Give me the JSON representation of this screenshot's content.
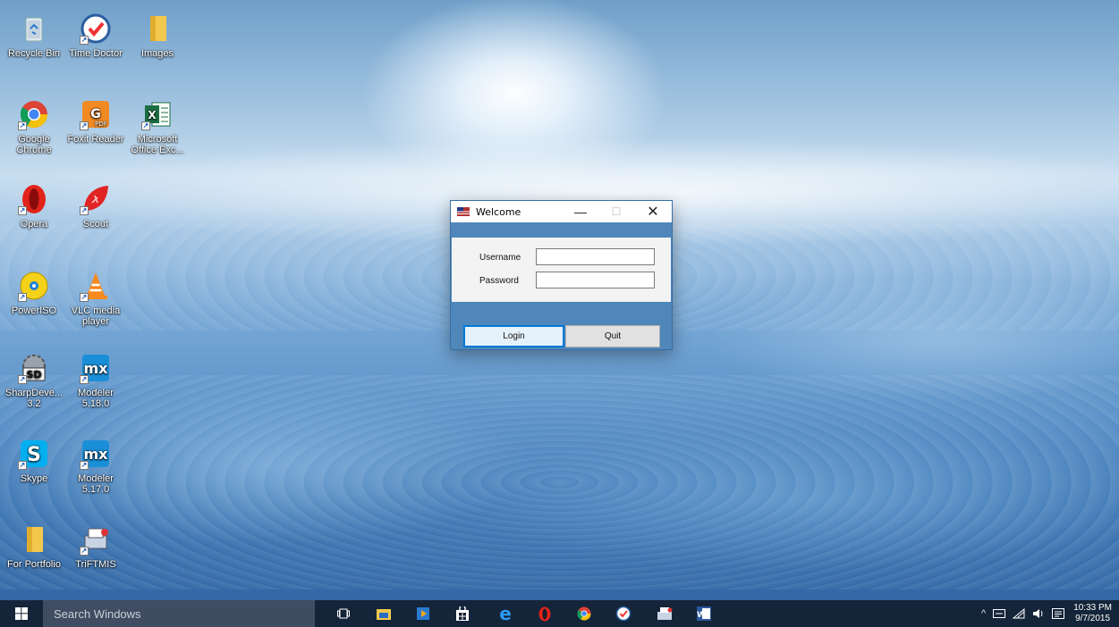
{
  "desktop": {
    "icons": [
      {
        "label": "Recycle Bin"
      },
      {
        "label": "Time Doctor"
      },
      {
        "label": "Images"
      },
      {
        "label": "Google Chrome"
      },
      {
        "label": "Foxit Reader"
      },
      {
        "label": "Microsoft Office Exc..."
      },
      {
        "label": "Opera"
      },
      {
        "label": "Scout"
      },
      {
        "label": "PowerISO"
      },
      {
        "label": "VLC media player"
      },
      {
        "label": "SharpDeve... 3.2"
      },
      {
        "label": "Modeler 5.18.0"
      },
      {
        "label": "Skype"
      },
      {
        "label": "Modeler 5.17.0"
      },
      {
        "label": "For Portfolio"
      },
      {
        "label": "TriFTMIS"
      }
    ]
  },
  "dialog": {
    "title": "Welcome",
    "username_label": "Username",
    "password_label": "Password",
    "username_value": "",
    "password_value": "",
    "login_label": "Login",
    "quit_label": "Quit",
    "minimize_symbol": "—",
    "maximize_symbol": "☐",
    "close_symbol": "✕"
  },
  "taskbar": {
    "search_placeholder": "Search Windows",
    "apps": [
      "task-view",
      "file-explorer",
      "media-player",
      "store",
      "edge",
      "opera",
      "chrome",
      "time-doctor",
      "triftmis",
      "word"
    ],
    "tray": {
      "chevron": "^",
      "clock_time": "10:33 PM",
      "clock_date": "9/7/2015"
    }
  },
  "colors": {
    "dialog_blue": "#4f87bb",
    "taskbar": "#121e30",
    "focus_blue": "#0078d7"
  }
}
